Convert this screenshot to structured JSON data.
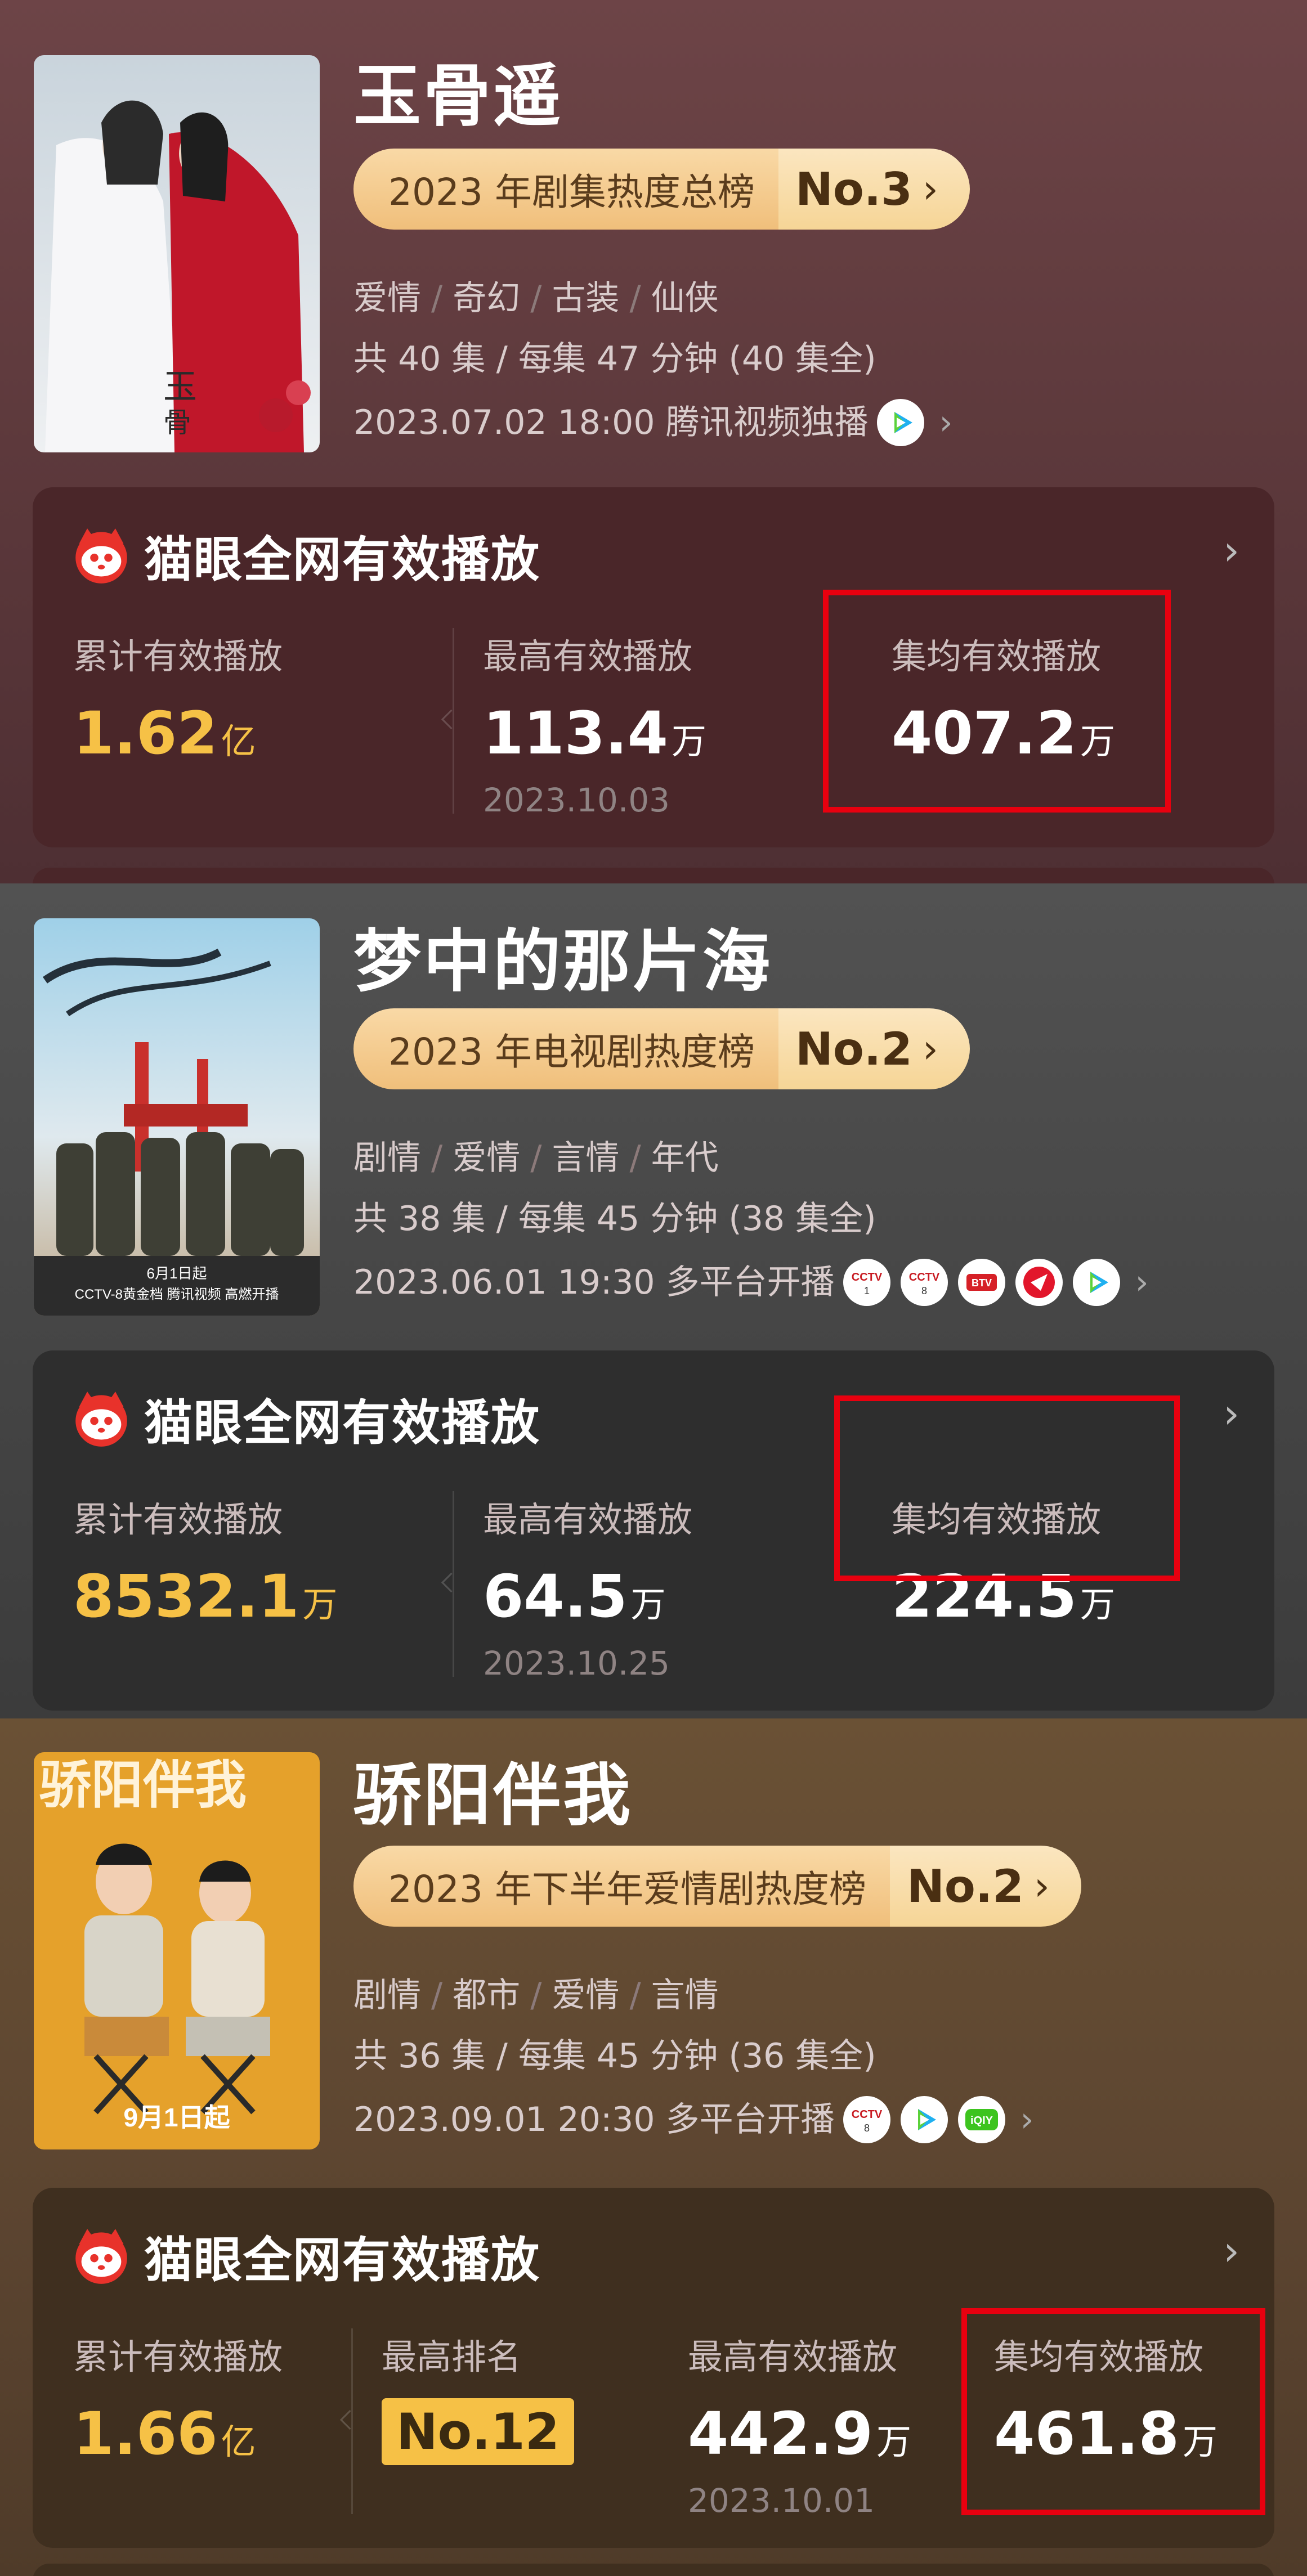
{
  "shows": [
    {
      "title": "玉骨遥",
      "rank": {
        "label": "2023 年剧集热度总榜",
        "position": "No.3",
        "chevron": "›"
      },
      "genres": [
        "爱情",
        "奇幻",
        "古装",
        "仙侠"
      ],
      "episodes": "共 40 集 / 每集 47 分钟 (40 集全)",
      "release": "2023.07.02 18:00 腾讯视频独播",
      "platforms": [
        "tencent-video-icon"
      ],
      "card": {
        "title": "猫眼全网有效播放",
        "cumulative_label": "累计有效播放",
        "cumulative_value": "1.62",
        "cumulative_unit": "亿",
        "peak_label": "最高有效播放",
        "peak_value": "113.4",
        "peak_unit": "万",
        "peak_date": "2023.10.03",
        "avg_label": "集均有效播放",
        "avg_value": "407.2",
        "avg_unit": "万"
      }
    },
    {
      "title": "梦中的那片海",
      "rank": {
        "label": "2023 年电视剧热度榜",
        "position": "No.2",
        "chevron": "›"
      },
      "genres": [
        "剧情",
        "爱情",
        "言情",
        "年代"
      ],
      "episodes": "共 38 集 / 每集 45 分钟 (38 集全)",
      "release": "2023.06.01 19:30 多平台开播",
      "platforms": [
        "cctv1-icon",
        "cctv8-icon",
        "btv-icon",
        "dragon-tv-icon",
        "tencent-video-icon"
      ],
      "poster_text": {
        "date": "6月1日起",
        "line": "CCTV-8黄金档 腾讯视频 高燃开播"
      },
      "card": {
        "title": "猫眼全网有效播放",
        "cumulative_label": "累计有效播放",
        "cumulative_value": "8532.1",
        "cumulative_unit": "万",
        "peak_label": "最高有效播放",
        "peak_value": "64.5",
        "peak_unit": "万",
        "peak_date": "2023.10.25",
        "avg_label": "集均有效播放",
        "avg_value": "224.5",
        "avg_unit": "万"
      }
    },
    {
      "title": "骄阳伴我",
      "rank": {
        "label": "2023 年下半年爱情剧热度榜",
        "position": "No.2",
        "chevron": "›"
      },
      "genres": [
        "剧情",
        "都市",
        "爱情",
        "言情"
      ],
      "episodes": "共 36 集 / 每集 45 分钟 (36 集全)",
      "release": "2023.09.01 20:30 多平台开播",
      "platforms": [
        "cctv8-icon",
        "tencent-video-icon",
        "iqiyi-icon"
      ],
      "poster_text": {
        "title": "骄阳伴我",
        "date": "9月1日起"
      },
      "card": {
        "title": "猫眼全网有效播放",
        "cumulative_label": "累计有效播放",
        "cumulative_value": "1.66",
        "cumulative_unit": "亿",
        "best_rank_label": "最高排名",
        "best_rank_value": "No.12",
        "peak_label": "最高有效播放",
        "peak_value": "442.9",
        "peak_unit": "万",
        "peak_date": "2023.10.01",
        "avg_label": "集均有效播放",
        "avg_value": "461.8",
        "avg_unit": "万"
      }
    }
  ],
  "colors": {
    "gold": "#f6c146",
    "highlight": "#e8000f",
    "pill": "#f6d596"
  },
  "separator": "/"
}
